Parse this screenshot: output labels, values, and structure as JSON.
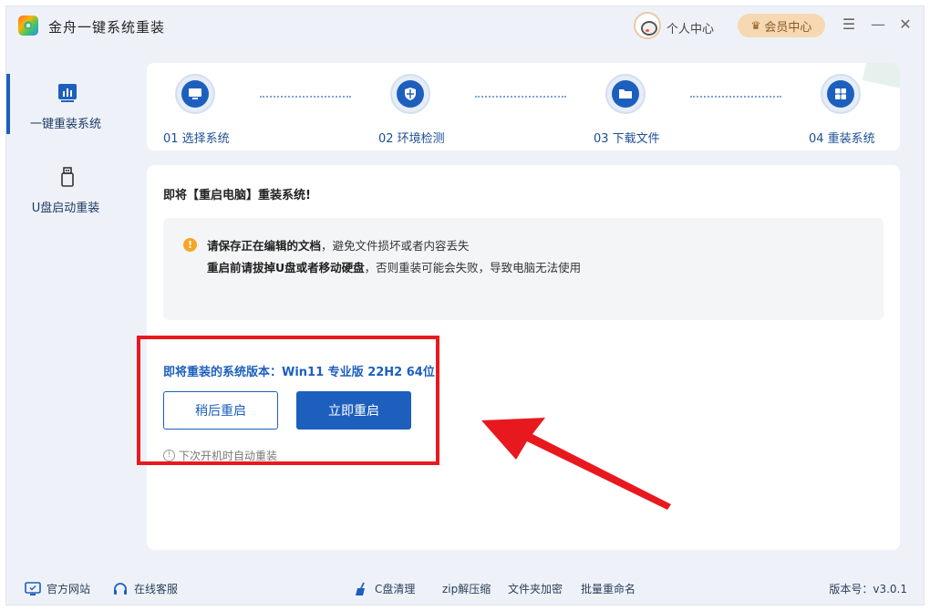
{
  "app": {
    "title": "金舟一键系统重装"
  },
  "header": {
    "personal_center": "个人中心",
    "vip_center": "会员中心",
    "menu_icon": "menu-icon",
    "minimize_icon": "minimize-icon",
    "close_icon": "close-icon"
  },
  "sidebar": {
    "items": [
      {
        "label": "一键重装系统",
        "icon": "chart-icon",
        "active": true
      },
      {
        "label": "U盘启动重装",
        "icon": "usb-icon",
        "active": false
      }
    ]
  },
  "steps": [
    {
      "label": "01 选择系统",
      "icon": "monitor-icon"
    },
    {
      "label": "02 环境检测",
      "icon": "shield-icon"
    },
    {
      "label": "03 下载文件",
      "icon": "folder-icon"
    },
    {
      "label": "04 重装系统",
      "icon": "windows-icon"
    }
  ],
  "main": {
    "heading": "即将【重启电脑】重装系统!",
    "notice": {
      "line1_bold": "请保存正在编辑的文档",
      "line1_rest": "，避免文件损坏或者内容丢失",
      "line2_bold": "重启前请拔掉U盘或者移动硬盘",
      "line2_rest": "，否则重装可能会失败，导致电脑无法使用"
    },
    "version_line": "即将重装的系统版本：Win11 专业版 22H2 64位",
    "later_button": "稍后重启",
    "now_button": "立即重启",
    "auto_hint": "下次开机时自动重装"
  },
  "footer": {
    "website": "官方网站",
    "support": "在线客服",
    "clean": "C盘清理",
    "zip": "zip解压缩",
    "encrypt": "文件夹加密",
    "rename": "批量重命名",
    "version": "版本号：v3.0.1"
  },
  "colors": {
    "accent": "#1d5fbd",
    "annotation": "#e8191e",
    "warning": "#f5a623"
  }
}
